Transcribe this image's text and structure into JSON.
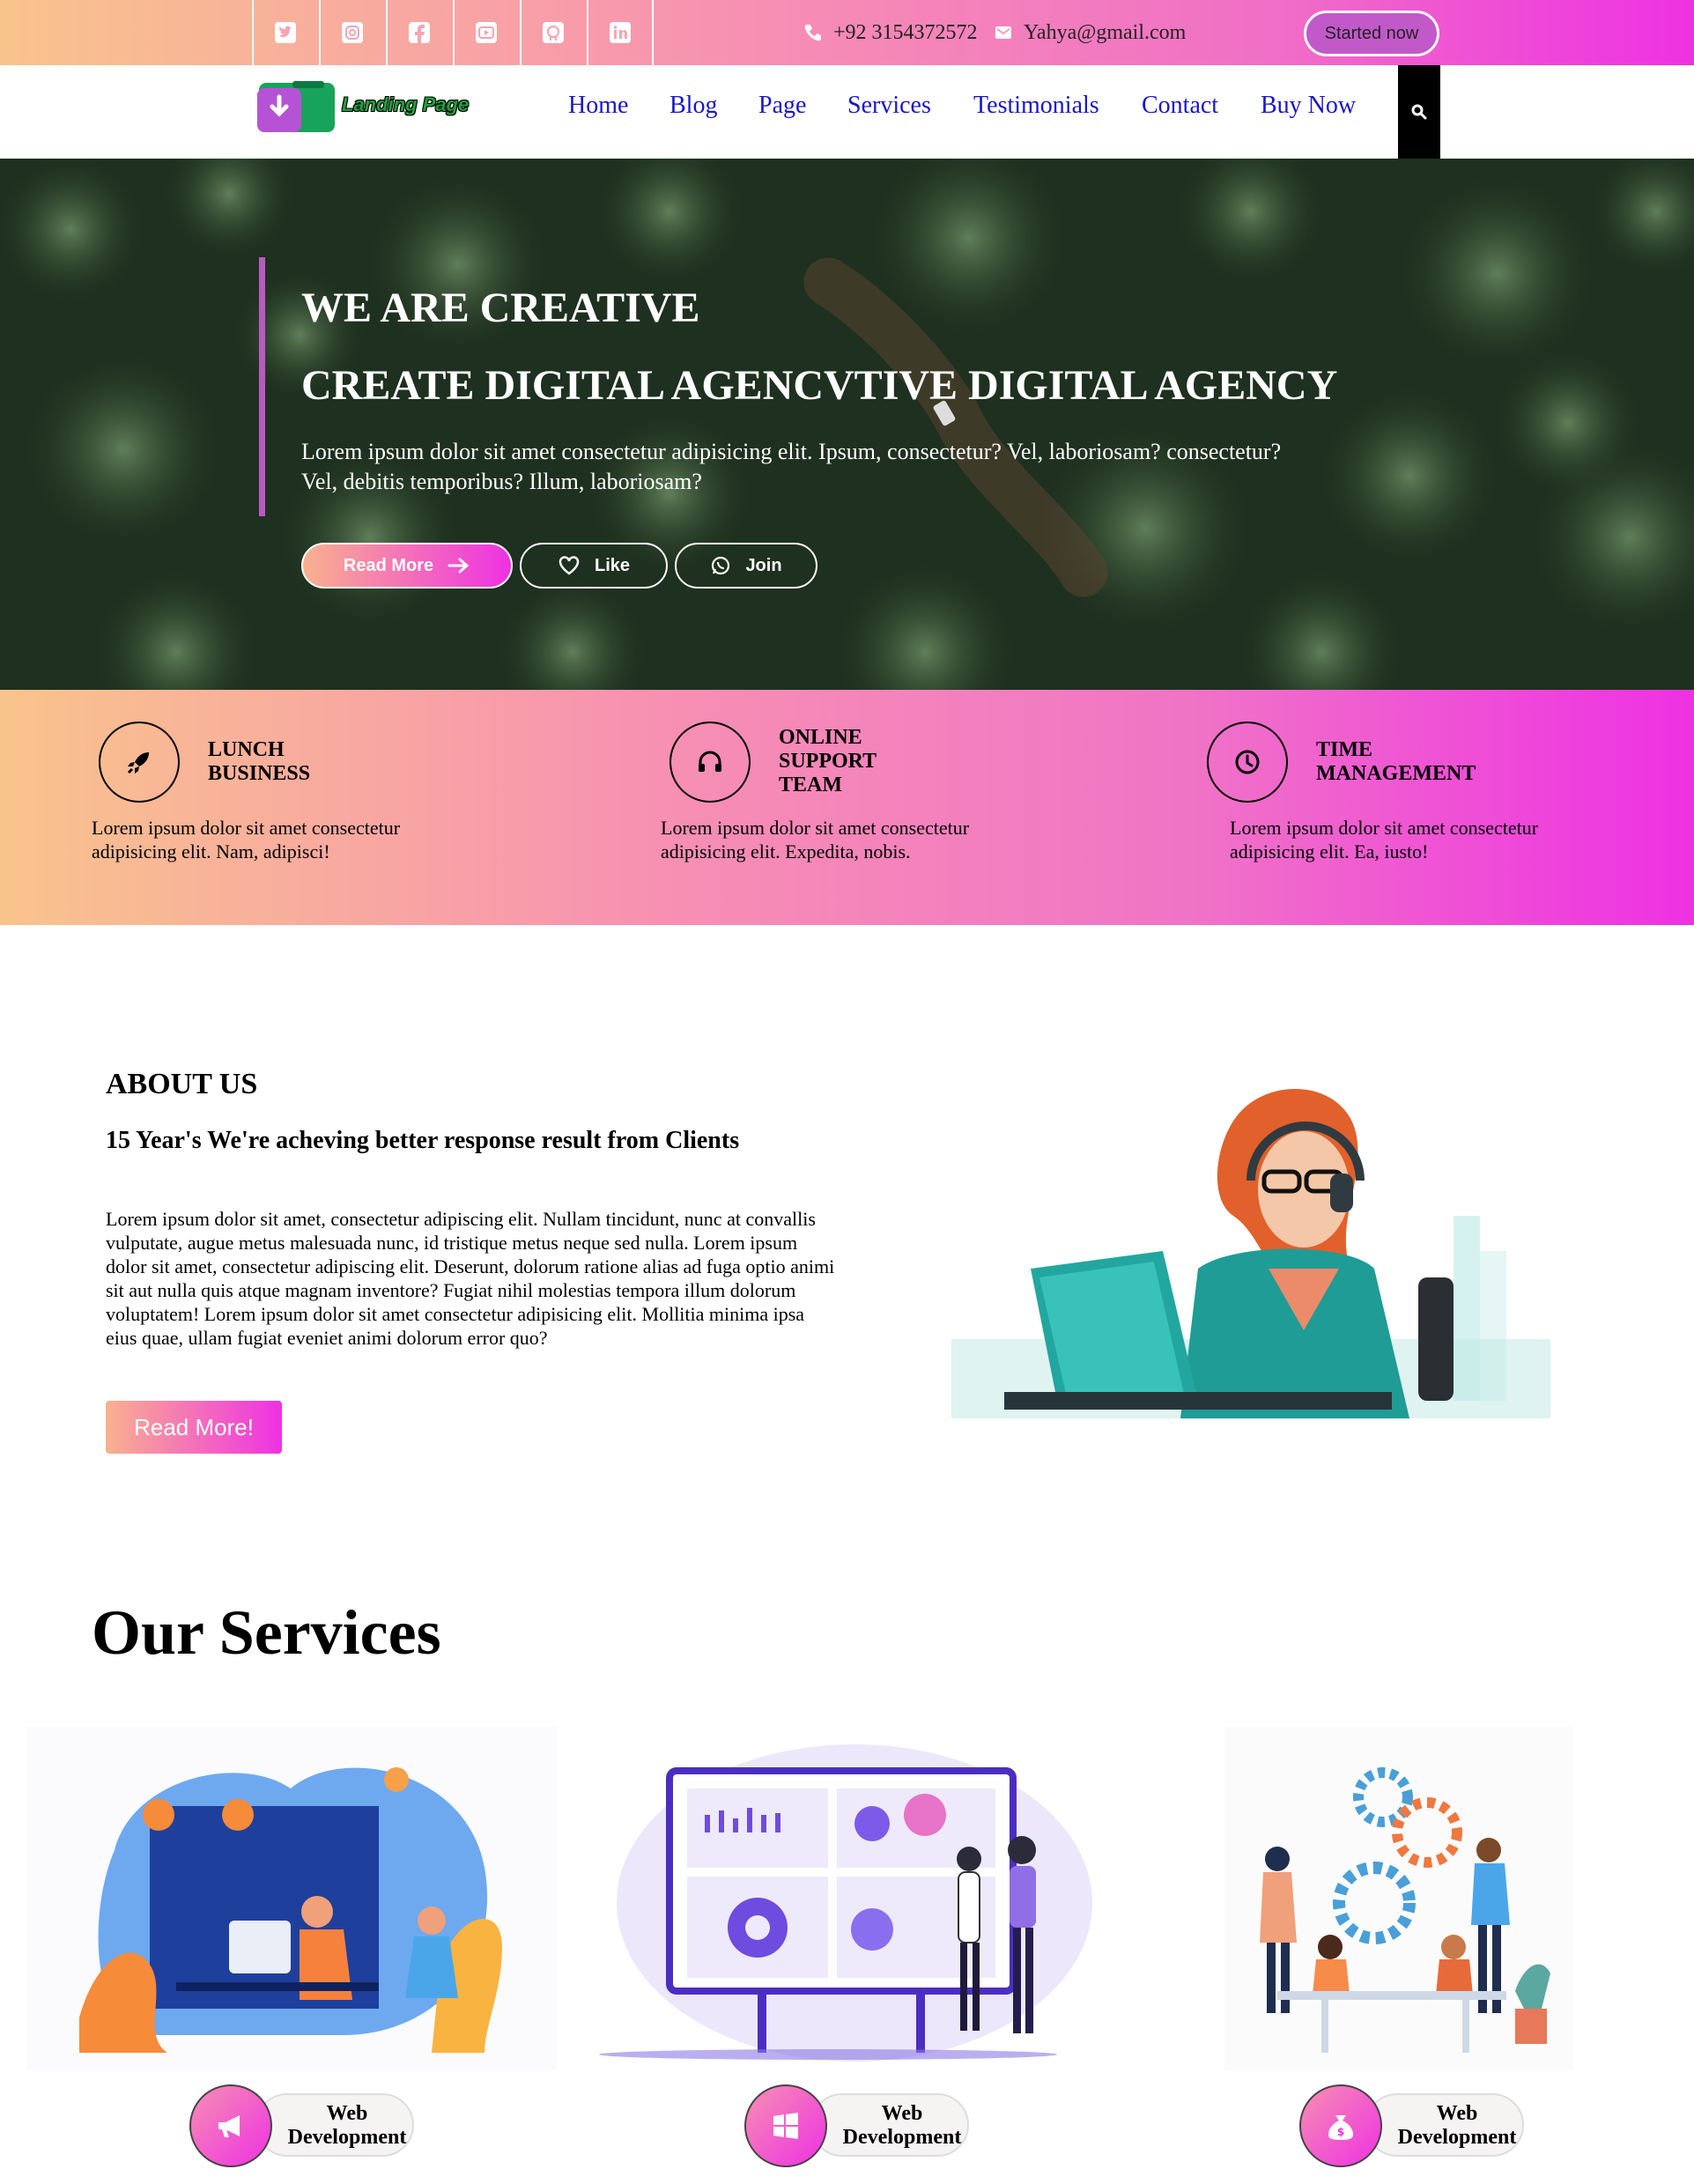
{
  "topbar": {
    "social": [
      "twitter-icon",
      "instagram-icon",
      "facebook-icon",
      "youtube-icon",
      "github-icon",
      "linkedin-icon"
    ],
    "phone": "+92 3154372572",
    "email": "Yahya@gmail.com",
    "cta": "Started now"
  },
  "nav": {
    "logo_text": "Landing Page",
    "links": [
      "Home",
      "Blog",
      "Page",
      "Services",
      "Testimonials",
      "Contact",
      "Buy Now"
    ]
  },
  "hero": {
    "title_1": "WE ARE CREATIVE",
    "title_2": "CREATE DIGITAL AGENCVTIVE DIGITAL AGENCY",
    "text": "Lorem ipsum dolor sit amet consectetur adipisicing elit. Ipsum, consectetur? Vel, laboriosam? consectetur? Vel, debitis temporibus? Illum, laboriosam?",
    "buttons": [
      "Read More",
      "Like",
      "Join"
    ]
  },
  "features": [
    {
      "title_1": "LUNCH",
      "title_2": "BUSINESS",
      "title_3": "",
      "icon": "rocket-icon",
      "text": "Lorem ipsum dolor sit amet consectetur adipisicing elit. Nam, adipisci!"
    },
    {
      "title_1": "ONLINE",
      "title_2": "SUPPORT",
      "title_3": "TEAM",
      "icon": "headphones-icon",
      "text": "Lorem ipsum dolor sit amet consectetur adipisicing elit. Expedita, nobis."
    },
    {
      "title_1": "TIME",
      "title_2": "MANAGEMENT",
      "title_3": "",
      "icon": "clock-icon",
      "text": "Lorem ipsum dolor sit amet consectetur adipisicing elit. Ea, iusto!"
    }
  ],
  "about": {
    "heading": "ABOUT US",
    "subheading": "15 Year's We're acheving better response result from Clients",
    "text": "Lorem ipsum dolor sit amet, consectetur adipiscing elit. Nullam tincidunt, nunc at convallis vulputate, augue metus malesuada nunc, id tristique metus neque sed nulla. Lorem ipsum dolor sit amet, consectetur adipiscing elit. Deserunt, dolorum ratione alias ad fuga optio animi sit aut nulla quis atque magnam inventore? Fugiat nihil molestias tempora illum dolorum voluptatem! Lorem ipsum dolor sit amet consectetur adipisicing elit. Mollitia minima ipsa eius quae, ullam fugiat eveniet animi dolorum error quo?",
    "button": "Read More!"
  },
  "services": {
    "heading": "Our Services",
    "items": [
      {
        "label_1": "Web",
        "label_2": "Development",
        "icon": "megaphone-icon"
      },
      {
        "label_1": "Web",
        "label_2": "Development",
        "icon": "windows-icon"
      },
      {
        "label_1": "Web",
        "label_2": "Development",
        "icon": "money-bag-icon"
      }
    ]
  },
  "colors": {
    "gradient_start": "#f9c48c",
    "gradient_mid": "#f78fb3",
    "gradient_end": "#ee31e3",
    "nav_link": "#1a16c8",
    "accent_purple": "#b959c1"
  }
}
